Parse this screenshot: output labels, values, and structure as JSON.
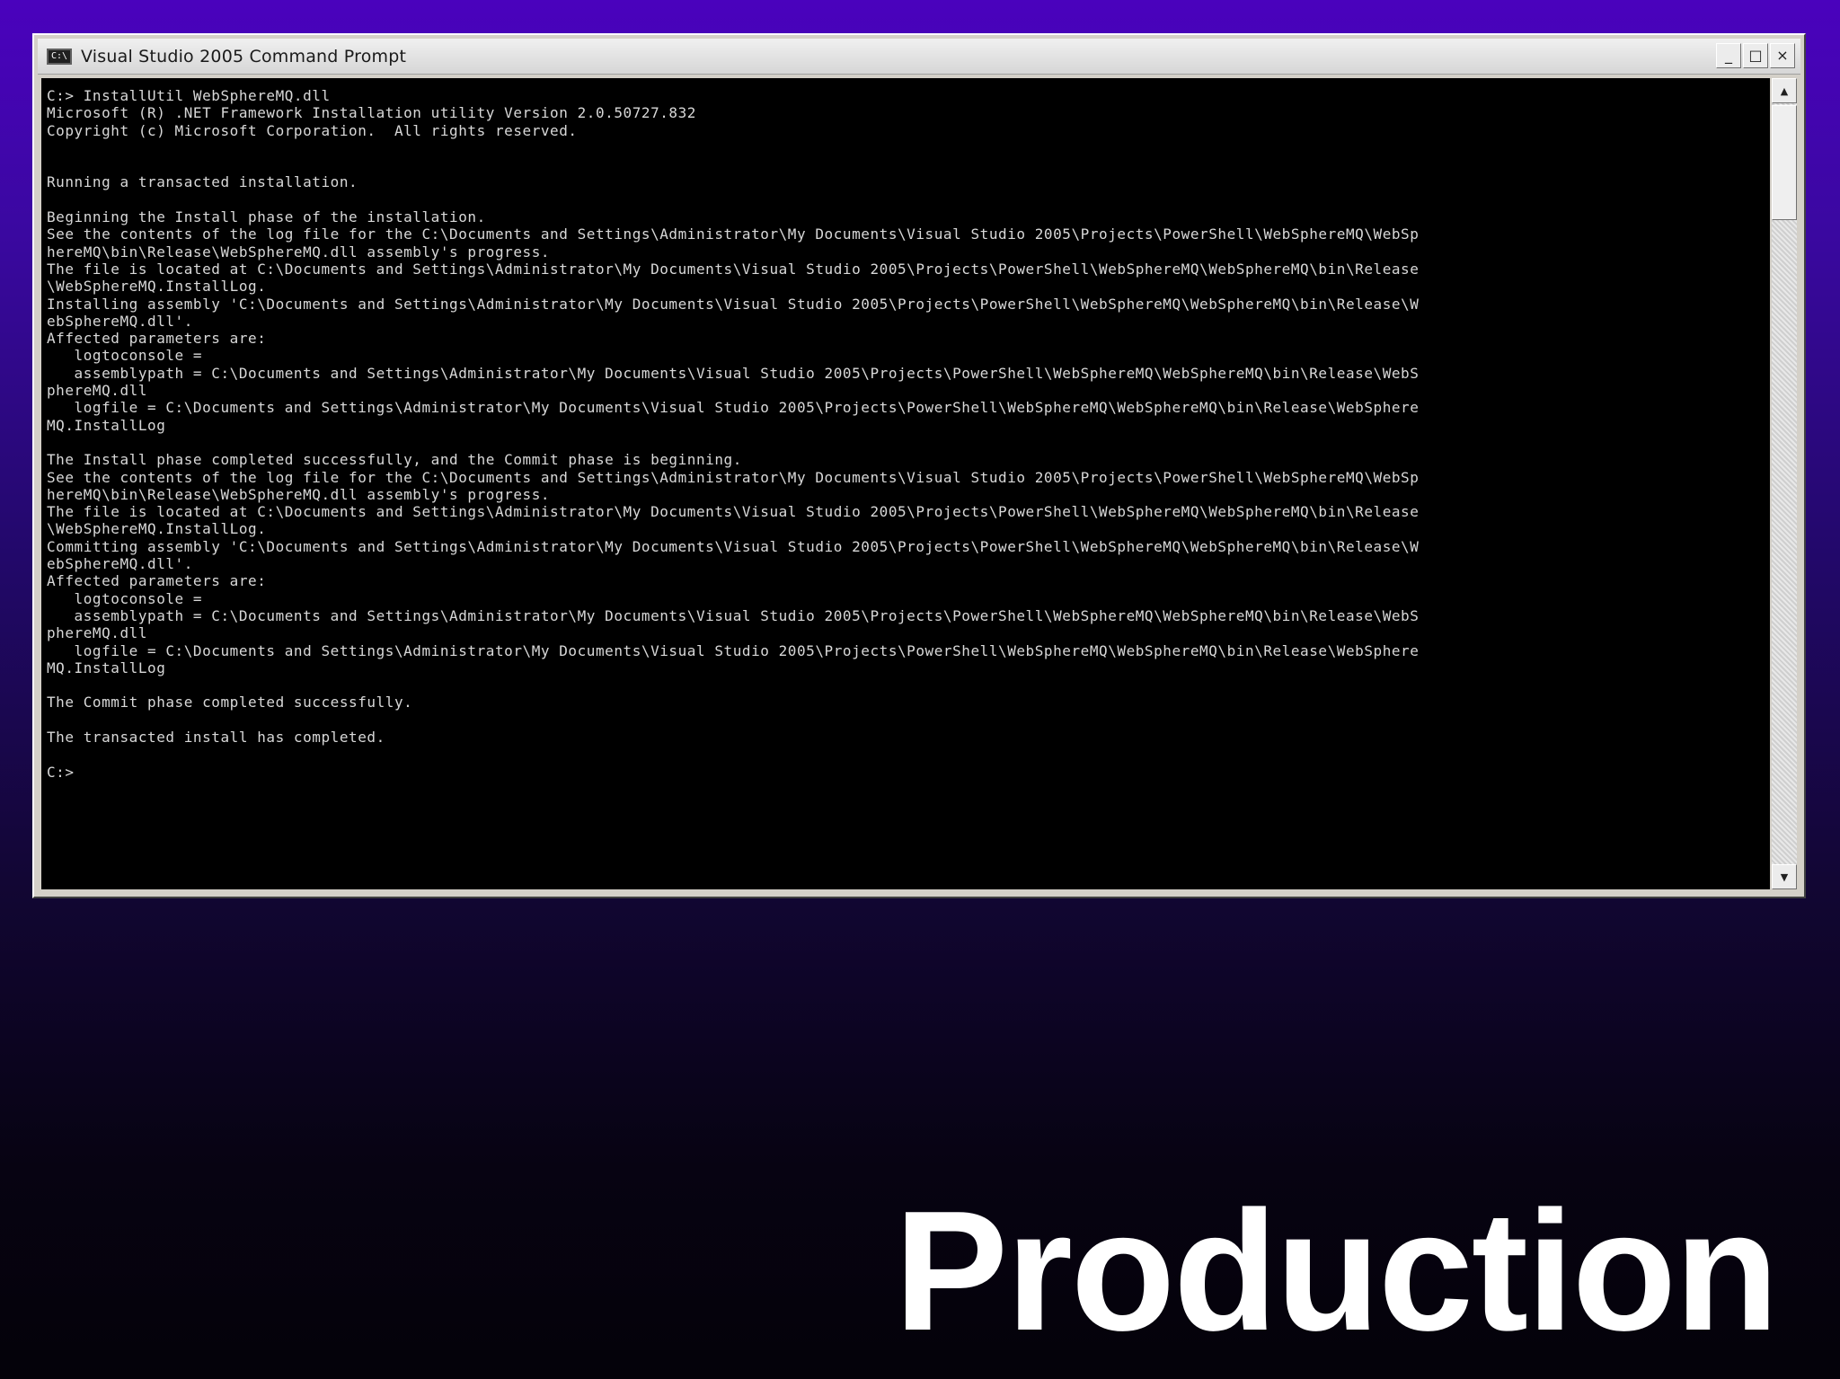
{
  "window": {
    "title": "Visual Studio 2005 Command Prompt",
    "icon": "console-window-icon",
    "icon_glyph": "C:\\",
    "controls": {
      "minimize": "_",
      "maximize": "□",
      "close": "×"
    }
  },
  "scrollbar": {
    "up_arrow": "▲",
    "down_arrow": "▼",
    "position": 0.0
  },
  "console": {
    "lines": [
      "C:> InstallUtil WebSphereMQ.dll",
      "Microsoft (R) .NET Framework Installation utility Version 2.0.50727.832",
      "Copyright (c) Microsoft Corporation.  All rights reserved.",
      "",
      "",
      "Running a transacted installation.",
      "",
      "Beginning the Install phase of the installation.",
      "See the contents of the log file for the C:\\Documents and Settings\\Administrator\\My Documents\\Visual Studio 2005\\Projects\\PowerShell\\WebSphereMQ\\WebSp",
      "hereMQ\\bin\\Release\\WebSphereMQ.dll assembly's progress.",
      "The file is located at C:\\Documents and Settings\\Administrator\\My Documents\\Visual Studio 2005\\Projects\\PowerShell\\WebSphereMQ\\WebSphereMQ\\bin\\Release",
      "\\WebSphereMQ.InstallLog.",
      "Installing assembly 'C:\\Documents and Settings\\Administrator\\My Documents\\Visual Studio 2005\\Projects\\PowerShell\\WebSphereMQ\\WebSphereMQ\\bin\\Release\\W",
      "ebSphereMQ.dll'.",
      "Affected parameters are:",
      "   logtoconsole =",
      "   assemblypath = C:\\Documents and Settings\\Administrator\\My Documents\\Visual Studio 2005\\Projects\\PowerShell\\WebSphereMQ\\WebSphereMQ\\bin\\Release\\WebS",
      "phereMQ.dll",
      "   logfile = C:\\Documents and Settings\\Administrator\\My Documents\\Visual Studio 2005\\Projects\\PowerShell\\WebSphereMQ\\WebSphereMQ\\bin\\Release\\WebSphere",
      "MQ.InstallLog",
      "",
      "The Install phase completed successfully, and the Commit phase is beginning.",
      "See the contents of the log file for the C:\\Documents and Settings\\Administrator\\My Documents\\Visual Studio 2005\\Projects\\PowerShell\\WebSphereMQ\\WebSp",
      "hereMQ\\bin\\Release\\WebSphereMQ.dll assembly's progress.",
      "The file is located at C:\\Documents and Settings\\Administrator\\My Documents\\Visual Studio 2005\\Projects\\PowerShell\\WebSphereMQ\\WebSphereMQ\\bin\\Release",
      "\\WebSphereMQ.InstallLog.",
      "Committing assembly 'C:\\Documents and Settings\\Administrator\\My Documents\\Visual Studio 2005\\Projects\\PowerShell\\WebSphereMQ\\WebSphereMQ\\bin\\Release\\W",
      "ebSphereMQ.dll'.",
      "Affected parameters are:",
      "   logtoconsole =",
      "   assemblypath = C:\\Documents and Settings\\Administrator\\My Documents\\Visual Studio 2005\\Projects\\PowerShell\\WebSphereMQ\\WebSphereMQ\\bin\\Release\\WebS",
      "phereMQ.dll",
      "   logfile = C:\\Documents and Settings\\Administrator\\My Documents\\Visual Studio 2005\\Projects\\PowerShell\\WebSphereMQ\\WebSphereMQ\\bin\\Release\\WebSphere",
      "MQ.InstallLog",
      "",
      "The Commit phase completed successfully.",
      "",
      "The transacted install has completed.",
      "",
      "C:>"
    ]
  },
  "slide": {
    "title": "Production"
  },
  "colors": {
    "background_top": "#4a02bd",
    "background_bottom": "#040209",
    "console_bg": "#000000",
    "console_text": "#d8d8d8",
    "window_chrome": "#d4d0c8"
  }
}
